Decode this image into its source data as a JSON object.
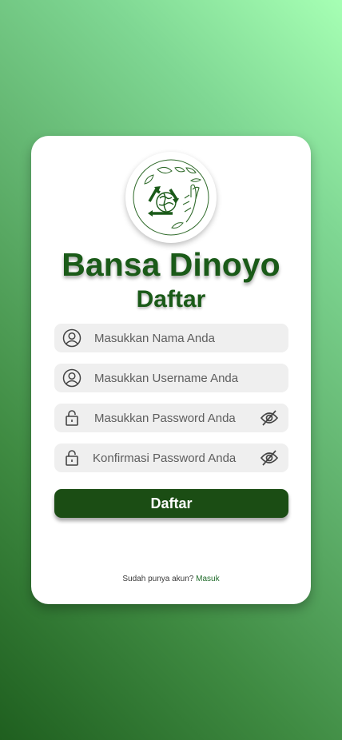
{
  "app": {
    "name": "Bansa Dinoyo",
    "page_title": "Daftar"
  },
  "colors": {
    "brand_green": "#1a5a18",
    "button": "#1b4d14",
    "field_bg": "#efefef",
    "link": "#1f6b2a"
  },
  "form": {
    "fields": [
      {
        "placeholder": "Masukkan Nama Anda",
        "icon": "user-circle-icon",
        "type": "text",
        "value": ""
      },
      {
        "placeholder": "Masukkan Username Anda",
        "icon": "user-circle-icon",
        "type": "text",
        "value": ""
      },
      {
        "placeholder": "Masukkan Password Anda",
        "icon": "lock-icon",
        "type": "password",
        "value": "",
        "toggle_icon": "eye-off-icon"
      },
      {
        "placeholder": "Konfirmasi Password Anda",
        "icon": "lock-icon",
        "type": "password",
        "value": "",
        "toggle_icon": "eye-off-icon"
      }
    ],
    "submit_label": "Daftar"
  },
  "footer": {
    "prompt": "Sudah punya akun?",
    "link_label": "Masuk"
  },
  "logo": {
    "icon": "recycle-earth-hand-leaves-logo"
  }
}
